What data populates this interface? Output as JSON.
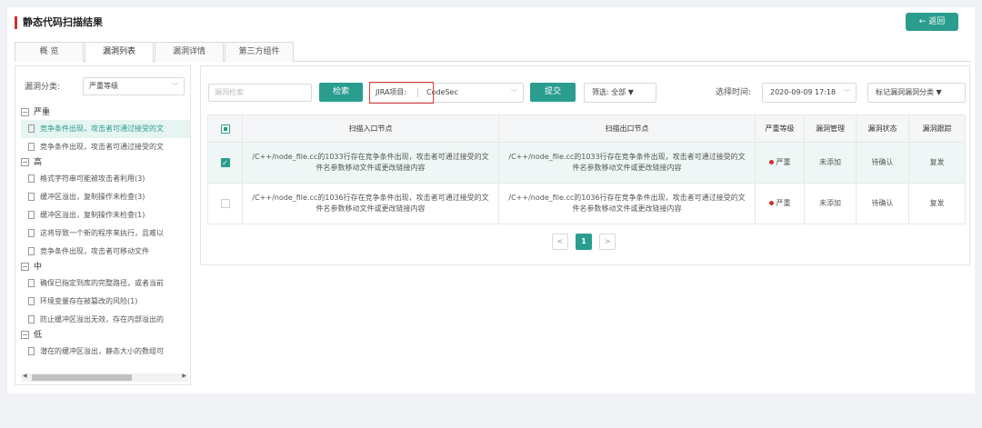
{
  "header": {
    "title": "静态代码扫描结果",
    "back_label": "← 返回"
  },
  "tabs": [
    "概 览",
    "漏洞列表",
    "漏洞详情",
    "第三方组件"
  ],
  "sidebar": {
    "category_label": "漏洞分类:",
    "category_value": "严重等级",
    "tree": [
      {
        "group": "严重",
        "items": [
          "竞争条件出现，攻击者可通过接受的文",
          "竞争条件出现，攻击者可通过接受的文"
        ]
      },
      {
        "group": "高",
        "items": [
          "格式字符串可能被攻击者利用(3)",
          "缓冲区溢出，复制操作未检查(3)",
          "缓冲区溢出，复制操作未检查(1)",
          "这将导致一个新的程序来执行，且难以",
          "竞争条件出现，攻击者可移动文件"
        ]
      },
      {
        "group": "中",
        "items": [
          "确保已指定到库的完整路径，或者当前",
          "环境变量存在被篡改的风险(1)",
          "防止缓冲区溢出无效，存在内部溢出的"
        ]
      },
      {
        "group": "低",
        "items": [
          "潜在的缓冲区溢出，静态大小的数组可"
        ]
      }
    ]
  },
  "toolbar": {
    "search_placeholder": "漏洞检索",
    "search_btn": "检索",
    "jira_label": "JIRA项目:",
    "jira_value": "CodeSec",
    "submit_btn": "提交",
    "filter": "筛选: 全部 ▼",
    "time_label": "选择时间:",
    "time_value": "2020-09-09 17:18",
    "mark_btn": "标记漏洞漏洞分类 ▼"
  },
  "table": {
    "headers": [
      "扫描入口节点",
      "扫描出口节点",
      "严重等级",
      "漏洞管理",
      "漏洞状态",
      "漏洞跟踪"
    ],
    "rows": [
      {
        "entry": "/C++/node_file.cc的1033行存在竞争条件出现，攻击者可通过接受的文件名参数移动文件或更改链接内容",
        "exit": "/C++/node_file.cc的1033行存在竞争条件出现，攻击者可通过接受的文件名参数移动文件或更改链接内容",
        "level": "严重",
        "manage": "未添加",
        "status": "待确认",
        "track": "复发",
        "checked": true
      },
      {
        "entry": "/C++/node_file.cc的1036行存在竞争条件出现，攻击者可通过接受的文件名参数移动文件或更改链接内容",
        "exit": "/C++/node_file.cc的1036行存在竞争条件出现，攻击者可通过接受的文件名参数移动文件或更改链接内容",
        "level": "严重",
        "manage": "未添加",
        "status": "待确认",
        "track": "复发",
        "checked": false
      }
    ]
  },
  "pager": {
    "prev": "<",
    "page": "1",
    "next": ">"
  },
  "colors": {
    "accent": "#2a9d8f",
    "danger": "#d0312d",
    "warning": "#e08a3c"
  }
}
